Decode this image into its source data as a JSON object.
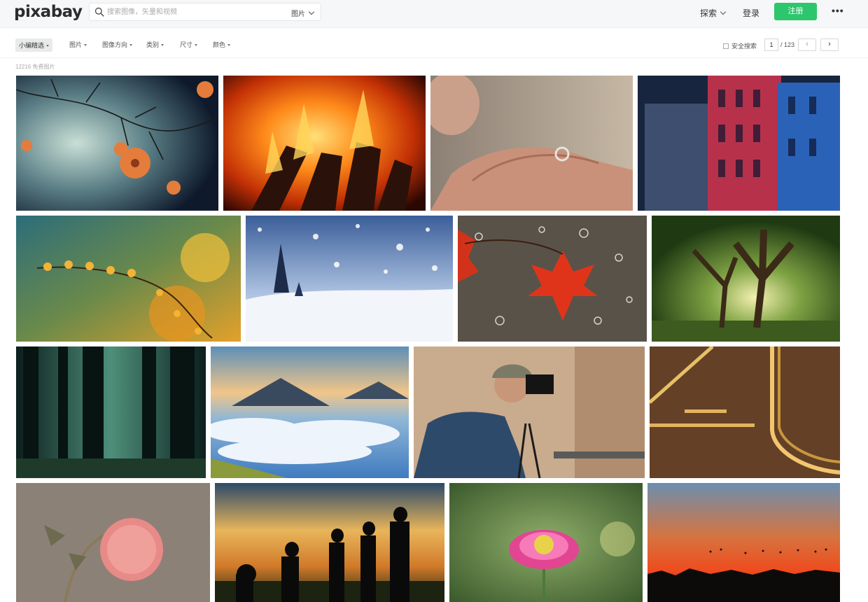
{
  "header": {
    "logo": "pixabay",
    "search_placeholder": "搜索图像，矢量和视频",
    "search_type": "图片",
    "explore": "探索",
    "login": "登录",
    "signup": "注册",
    "more": "•••"
  },
  "filters": {
    "editors_choice": "小编精选",
    "images": "图片",
    "orientation": "图像方向",
    "category": "类别",
    "size": "尺寸",
    "color": "颜色"
  },
  "toolbar": {
    "safe_search": "安全搜索",
    "page_current": "1",
    "page_total": "/ 123",
    "prev": "‹",
    "next": "›"
  },
  "result_count": "12216 免费图片",
  "colors": {
    "accent_green": "#2ec66d",
    "header_bg": "#f6f7f8"
  }
}
